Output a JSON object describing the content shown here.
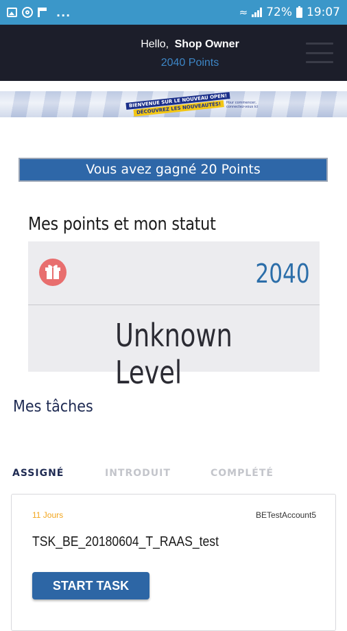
{
  "status_bar": {
    "battery": "72%",
    "time": "19:07",
    "overflow": "..."
  },
  "header": {
    "greeting": "Hello,",
    "user_name": "Shop Owner",
    "points": "2040 Points"
  },
  "banner": {
    "line1": "BIENVENUE SUR LE NOUVEAU OPEN!",
    "line2": "DÉCOUVREZ LES NOUVEAUTÉS!",
    "small_text": "Pour commencer, connectez-vous ici"
  },
  "reward_notice": "Vous avez gagné 20 Points",
  "status": {
    "heading": "Mes points et mon statut",
    "points": "2040",
    "level": "Unknown Level"
  },
  "tasks": {
    "heading": "Mes tâches",
    "tabs": [
      {
        "label": "ASSIGNÉ",
        "active": true
      },
      {
        "label": "INTRODUIT",
        "active": false
      },
      {
        "label": "COMPLÉTÉ",
        "active": false
      }
    ],
    "items": [
      {
        "days": "11 Jours",
        "account": "BETestAccount5",
        "title": "TSK_BE_20180604_T_RAAS_test",
        "button": "START TASK"
      }
    ]
  },
  "colors": {
    "status_bar": "#3b97c9",
    "header_bg": "#1c1e2a",
    "accent_blue": "#2e67a8",
    "gift": "#e86e6e",
    "days_orange": "#f2a51c"
  }
}
